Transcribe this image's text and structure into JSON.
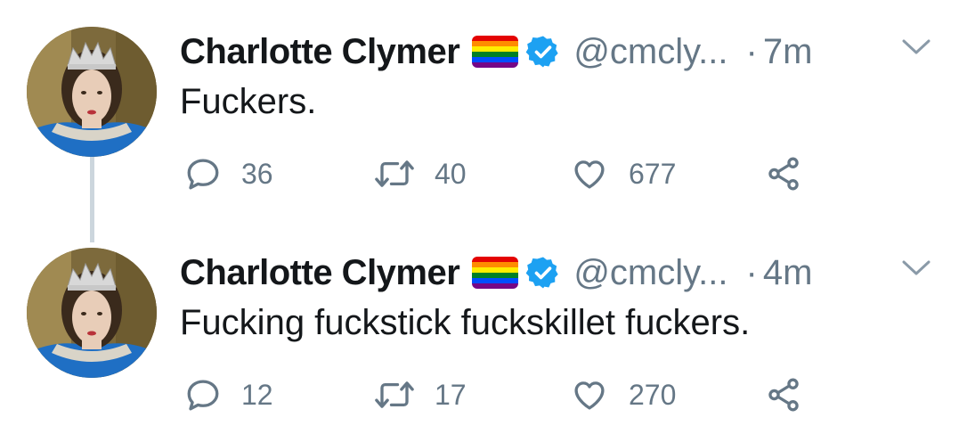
{
  "tweets": [
    {
      "name": "Charlotte Clymer",
      "handle": "@cmcly...",
      "separator": "·",
      "time": "7m",
      "text": "Fuckers.",
      "replies": "36",
      "retweets": "40",
      "likes": "677",
      "flag_icon": "rainbow-flag-icon",
      "verified_icon": "verified-badge-icon"
    },
    {
      "name": "Charlotte Clymer",
      "handle": "@cmcly...",
      "separator": "·",
      "time": "4m",
      "text": "Fucking fuckstick fuckskillet fuckers.",
      "replies": "12",
      "retweets": "17",
      "likes": "270",
      "flag_icon": "rainbow-flag-icon",
      "verified_icon": "verified-badge-icon"
    }
  ],
  "colors": {
    "text": "#14171a",
    "secondary": "#657786",
    "verified": "#1da1f2",
    "thread_line": "#ccd6dd"
  }
}
